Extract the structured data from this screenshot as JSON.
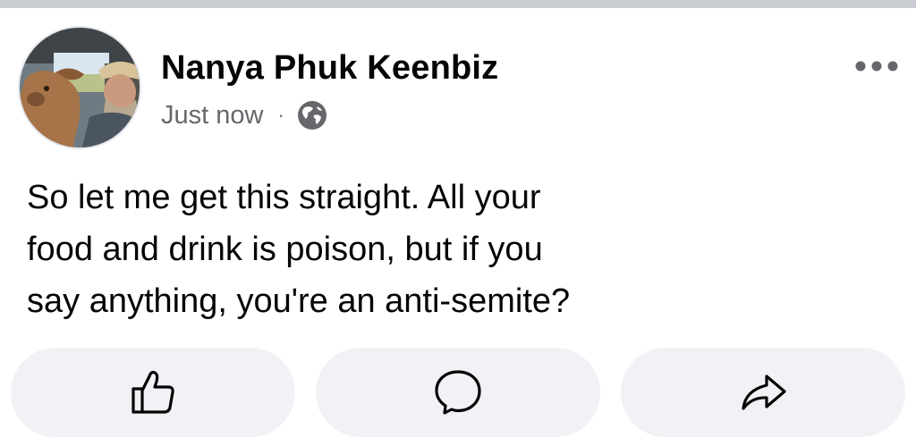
{
  "post": {
    "author_name": "Nanya Phuk Keenbiz",
    "timestamp": "Just now",
    "separator": "·",
    "privacy_icon": "globe-icon",
    "more_icon": "more-horizontal-icon",
    "text": "So let me get this straight. All your\nfood and drink is poison, but if you\nsay anything, you're an anti-semite?"
  },
  "actions": [
    {
      "icon": "thumbs-up-icon"
    },
    {
      "icon": "comment-bubble-icon"
    },
    {
      "icon": "share-arrow-icon"
    }
  ],
  "colors": {
    "text_primary": "#050505",
    "text_secondary": "#65676b",
    "button_bg": "#f0f2f5",
    "divider": "#c9ccd1"
  }
}
